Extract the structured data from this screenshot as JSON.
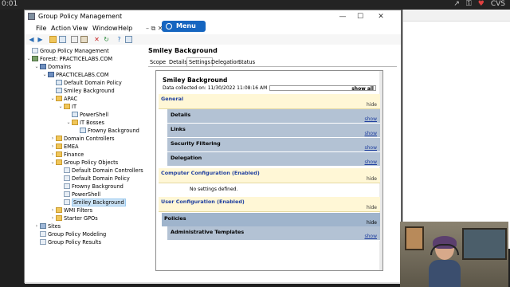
{
  "topbar": {
    "clock": "0:01",
    "tray_text": "CVS"
  },
  "window": {
    "title": "Group Policy Management",
    "controls": {
      "minimize": "—",
      "maximize": "☐",
      "close": "✕"
    }
  },
  "menubar": {
    "items": [
      "File",
      "Action",
      "View",
      "Window",
      "Help"
    ],
    "overlay_menu_label": "Menu",
    "right_controls": "– ⧉ ✕"
  },
  "toolbar": {
    "icons": [
      "back-icon",
      "forward-icon",
      "up-icon",
      "show-tree-icon",
      "copy-icon",
      "paste-icon",
      "delete-icon",
      "refresh-icon",
      "help-icon",
      "properties-icon"
    ]
  },
  "tree": {
    "root": "Group Policy Management",
    "forest": "Forest: PRACTICELABS.COM",
    "domains": "Domains",
    "domain": "PRACTICELABS.COM",
    "items": {
      "default_domain_policy": "Default Domain Policy",
      "smiley_background": "Smiley Background",
      "apac": "APAC",
      "it": "IT",
      "powershell": "PowerShell",
      "it_bosses": "IT Bosses",
      "frowny_background": "Frowny Background",
      "domain_controllers": "Domain Controllers",
      "emea": "EMEA",
      "finance": "Finance",
      "gpo_container": "Group Policy Objects",
      "gpo_default_dc": "Default Domain Controllers",
      "gpo_default_domain": "Default Domain Policy",
      "gpo_frowny": "Frowny Background",
      "gpo_powershell": "PowerShell",
      "gpo_smiley": "Smiley Background",
      "wmi_filters": "WMI Filters",
      "starter_gpos": "Starter GPOs",
      "sites": "Sites",
      "modeling": "Group Policy Modeling",
      "results": "Group Policy Results"
    }
  },
  "details": {
    "title": "Smiley Background",
    "tabs": [
      "Scope",
      "Details",
      "Settings",
      "Delegation",
      "Status"
    ],
    "active_tab": "Settings",
    "report": {
      "title": "Smiley Background",
      "date": "Data collected on: 11/30/2022 11:08:16 AM",
      "show_all": "show all",
      "general": "General",
      "hide": "hide",
      "show": "show",
      "general_items": [
        "Details",
        "Links",
        "Security Filtering",
        "Delegation"
      ],
      "computer_config": "Computer Configuration (Enabled)",
      "no_settings": "No settings defined.",
      "user_config": "User Configuration (Enabled)",
      "policies": "Policies",
      "admin_templates": "Administrative Templates"
    }
  },
  "colors": {
    "menu_button": "#1565c0",
    "section_header_bg": "#fff7d6",
    "section_header_text": "#1f3f9f",
    "subsection_bg": "#b3c2d4",
    "selection": "#cce4f7"
  }
}
